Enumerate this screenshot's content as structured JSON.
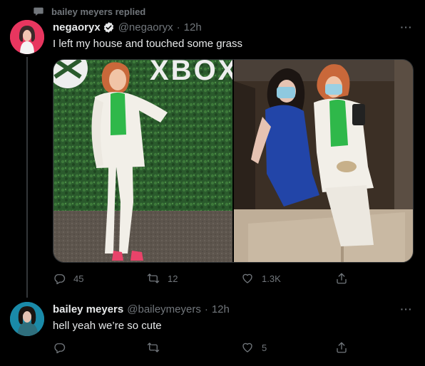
{
  "context": {
    "label": "bailey meyers replied",
    "icon": "reply-bubble-icon"
  },
  "tweet": {
    "display_name": "negaoryx",
    "handle": "@negaoryx",
    "time": "12h",
    "text": "I left my house and touched some grass",
    "backdrop_text": "XBOX",
    "stats": {
      "replies": "45",
      "retweets": "12",
      "likes": "1.3K"
    },
    "icons": [
      "comment-icon",
      "retweet-icon",
      "heart-icon",
      "share-icon"
    ]
  },
  "reply": {
    "display_name": "bailey meyers",
    "handle": "@baileymeyers",
    "time": "12h",
    "text": "hell yeah we’re so cute",
    "stats": {
      "replies": "",
      "retweets": "",
      "likes": "5"
    }
  },
  "colors": {
    "background": "#000000",
    "text": "#e7e9ea",
    "muted": "#71767b",
    "verified": "#1d9bf0",
    "divider": "#333639"
  }
}
